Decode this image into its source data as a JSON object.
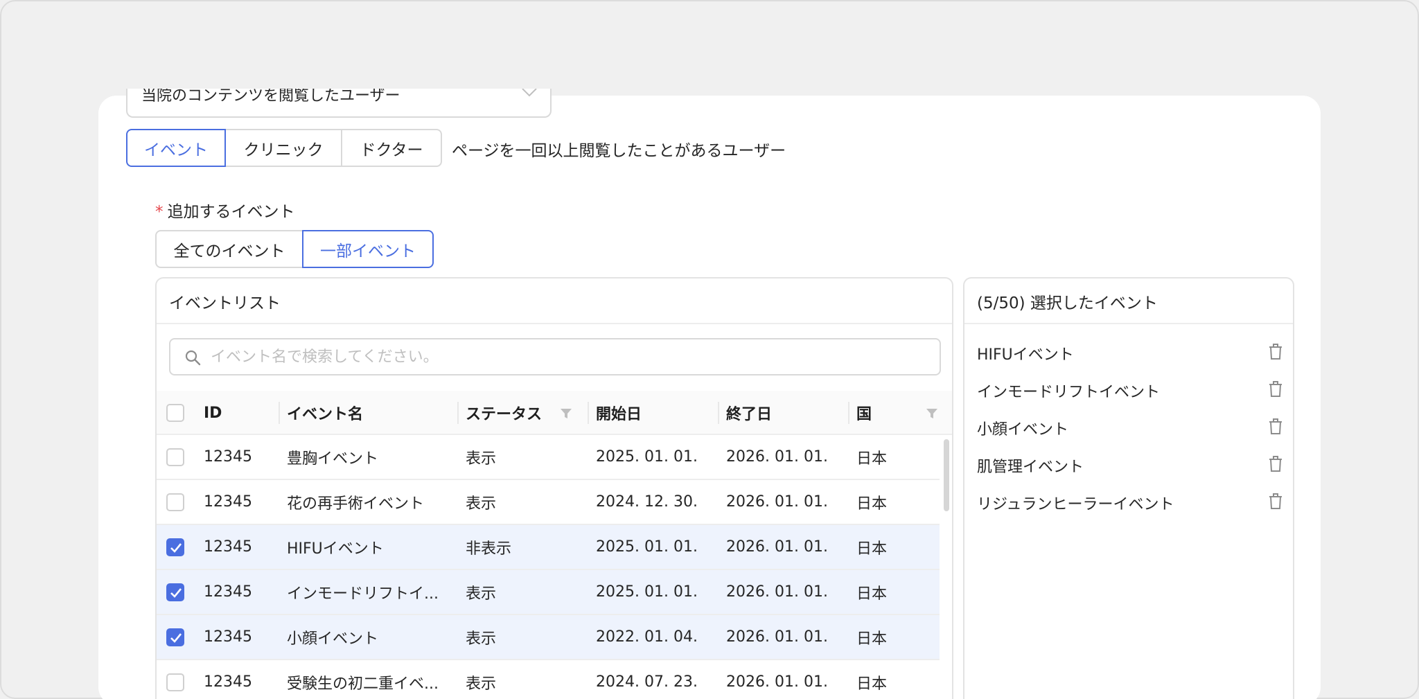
{
  "audience_select": {
    "value": "当院のコンテンツを閲覧したユーザー"
  },
  "content_tabs": [
    {
      "label": "イベント",
      "active": true
    },
    {
      "label": "クリニック",
      "active": false
    },
    {
      "label": "ドクター",
      "active": false
    }
  ],
  "condition_description": "ページを一回以上閲覧したことがあるユーザー",
  "event_field": {
    "required_mark": "*",
    "label": "追加するイベント",
    "options": [
      {
        "label": "全てのイベント",
        "active": false
      },
      {
        "label": "一部イベント",
        "active": true
      }
    ]
  },
  "event_list": {
    "title": "イベントリスト",
    "search_placeholder": "イベント名で検索してください。",
    "columns": {
      "id": "ID",
      "name": "イベント名",
      "status": "ステータス",
      "start": "開始日",
      "end": "終了日",
      "country": "国"
    },
    "rows": [
      {
        "checked": false,
        "id": "12345",
        "name": "豊胸イベント",
        "status": "表示",
        "start": "2025. 01. 01.",
        "end": "2026. 01. 01.",
        "country": "日本"
      },
      {
        "checked": false,
        "id": "12345",
        "name": "花の再手術イベント",
        "status": "表示",
        "start": "2024. 12. 30.",
        "end": "2026. 01. 01.",
        "country": "日本"
      },
      {
        "checked": true,
        "id": "12345",
        "name": "HIFUイベント",
        "status": "非表示",
        "start": "2025. 01. 01.",
        "end": "2026. 01. 01.",
        "country": "日本"
      },
      {
        "checked": true,
        "id": "12345",
        "name": "インモードリフトイ...",
        "status": "表示",
        "start": "2025. 01. 01.",
        "end": "2026. 01. 01.",
        "country": "日本"
      },
      {
        "checked": true,
        "id": "12345",
        "name": "小顔イベント",
        "status": "表示",
        "start": "2022. 01. 04.",
        "end": "2026. 01. 01.",
        "country": "日本"
      },
      {
        "checked": false,
        "id": "12345",
        "name": "受験生の初二重イベ...",
        "status": "表示",
        "start": "2024. 07. 23.",
        "end": "2026. 01. 01.",
        "country": "日本"
      }
    ]
  },
  "selected_events": {
    "title": "(5/50) 選択したイベント",
    "items": [
      "HIFUイベント",
      "インモードリフトイベント",
      "小顔イベント",
      "肌管理イベント",
      "リジュランヒーラーイベント"
    ]
  },
  "colors": {
    "accent": "#4a6ee0",
    "selected_row": "#eef3fd",
    "required": "#e5484d"
  }
}
